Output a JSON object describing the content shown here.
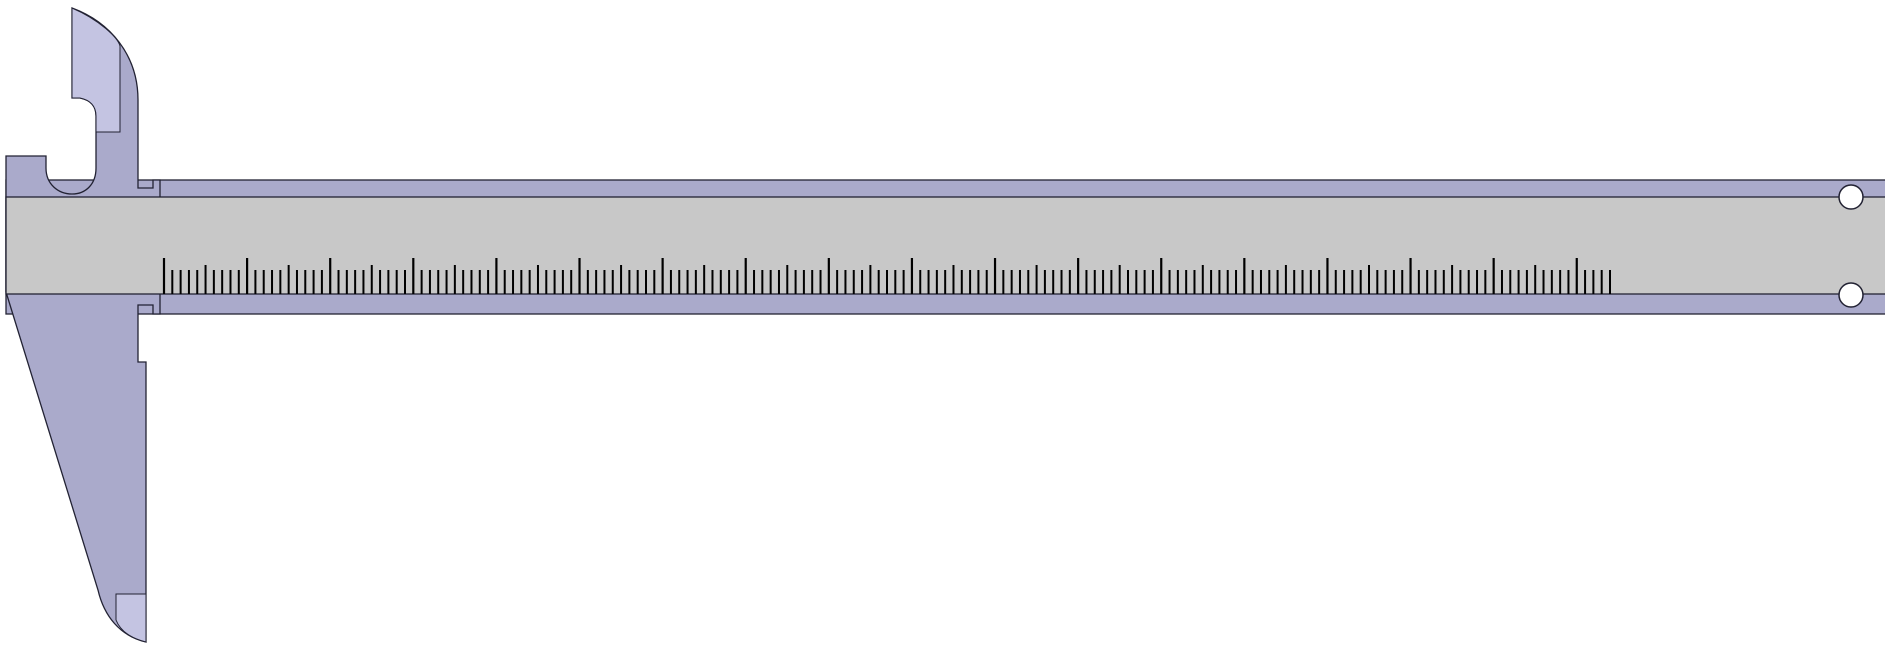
{
  "colors": {
    "background": "#ffffff",
    "body_fill": "#aaaacb",
    "jaw_fill": "#aaaacb",
    "jaw_tip_fill": "#c4c4e2",
    "scale_face_fill": "#c8c8c8",
    "outline": "#222233",
    "tick": "#000000",
    "screw_fill": "#ffffff"
  },
  "scale": {
    "major_every": 10,
    "mid_every": 5,
    "major_count": 17,
    "total_ticks": 175
  },
  "parts": [
    "fixed-jaw",
    "main-beam",
    "scale-face",
    "inside-jaw-upper",
    "outside-jaw-lower",
    "beam-screw-top",
    "beam-screw-bottom"
  ]
}
